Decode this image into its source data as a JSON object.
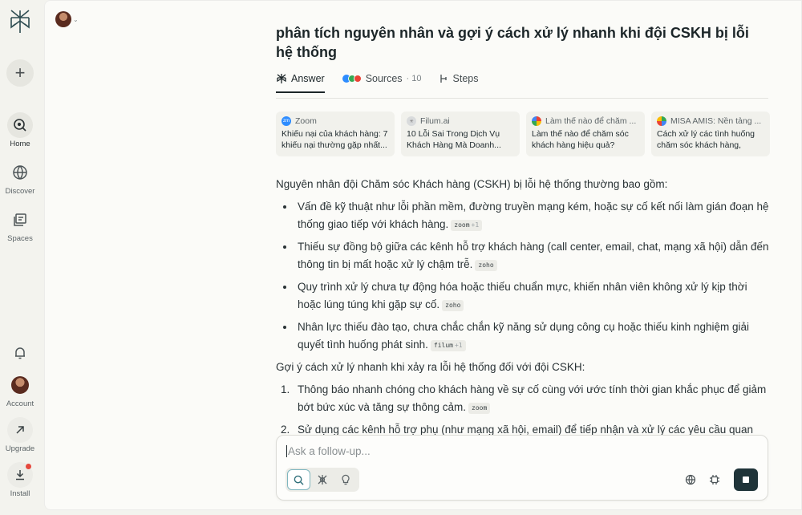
{
  "sidebar": {
    "new_label": "+",
    "items": [
      {
        "label": "Home"
      },
      {
        "label": "Discover"
      },
      {
        "label": "Spaces"
      }
    ],
    "account_label": "Account",
    "upgrade_label": "Upgrade",
    "install_label": "Install"
  },
  "question": "phân tích nguyên nhân và gợi ý cách xử lý nhanh khi đội CSKH bị lỗi hệ thống",
  "tabs": {
    "answer": "Answer",
    "sources": "Sources",
    "sources_count": "· 10",
    "steps": "Steps"
  },
  "sources": [
    {
      "site": "Zoom",
      "title": "Khiếu nại của khách hàng: 7 khiếu nại thường gặp nhất...",
      "fav_color": "#2d8cff",
      "fav_text": "zm"
    },
    {
      "site": "Filum.ai",
      "title": "10 Lỗi Sai Trong Dịch Vụ Khách Hàng Mà Doanh...",
      "fav_color": "#c9cccd",
      "fav_text": "✳"
    },
    {
      "site": "Làm thế nào để chăm ...",
      "title": "Làm thế nào để chăm sóc khách hàng hiệu quả?",
      "fav_color": "#ea4335",
      "fav_text": "G"
    },
    {
      "site": "MISA AMIS: Nền tảng ...",
      "title": "Cách xử lý các tình huống chăm sóc khách hàng, năn...",
      "fav_color": "#34a853",
      "fav_text": "●"
    }
  ],
  "answer": {
    "intro": "Nguyên nhân đội Chăm sóc Khách hàng (CSKH) bị lỗi hệ thống thường bao gồm:",
    "causes": [
      {
        "text": "Vấn đề kỹ thuật như lỗi phần mềm, đường truyền mạng kém, hoặc sự cố kết nối làm gián đoạn hệ thống giao tiếp với khách hàng.",
        "cite": "zoom",
        "plus": "+1"
      },
      {
        "text": "Thiếu sự đồng bộ giữa các kênh hỗ trợ khách hàng (call center, email, chat, mạng xã hội) dẫn đến thông tin bị mất hoặc xử lý chậm trễ.",
        "cite": "zoho",
        "plus": ""
      },
      {
        "text": "Quy trình xử lý chưa tự động hóa hoặc thiếu chuẩn mực, khiến nhân viên không xử lý kịp thời hoặc lúng túng khi gặp sự cố.",
        "cite": "zoho",
        "plus": ""
      },
      {
        "text": "Nhân lực thiếu đào tạo, chưa chắc chắn kỹ năng sử dụng công cụ hoặc thiếu kinh nghiệm giải quyết tình huống phát sinh.",
        "cite": "filum",
        "plus": "+1"
      }
    ],
    "solutions_intro": "Gợi ý cách xử lý nhanh khi xảy ra lỗi hệ thống đối với đội CSKH:",
    "solutions": [
      {
        "num": "1.",
        "text": "Thông báo nhanh chóng cho khách hàng về sự cố cùng với ước tính thời gian khắc phục để giảm bớt bức xúc và tăng sự thông cảm.",
        "cite": "zoom"
      },
      {
        "num": "2.",
        "text": "Sử dụng các kênh hỗ trợ phụ (như mạng xã hội, email) để tiếp nhận và xử lý các yêu cầu quan",
        "cite": ""
      }
    ]
  },
  "followup": {
    "placeholder": "Ask a follow-up..."
  },
  "colors": {
    "accent": "#1f3439",
    "notification": "#e5483d"
  }
}
